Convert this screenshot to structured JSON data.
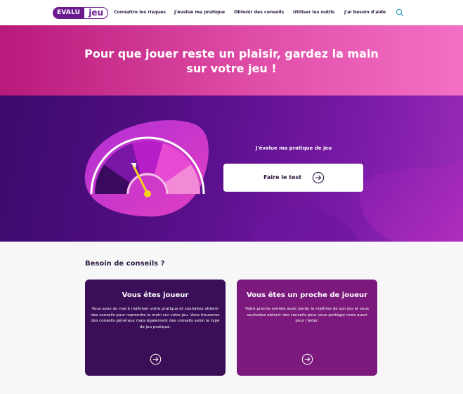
{
  "header": {
    "logo": {
      "left": "EVALU",
      "right": "jeu"
    },
    "nav": [
      {
        "label": "Connaitre les risques"
      },
      {
        "label": "J'évalue ma pratique"
      },
      {
        "label": "Obtenir des conseils"
      },
      {
        "label": "Utiliser les outils"
      },
      {
        "label": "J'ai besoin d'aide"
      }
    ],
    "search_icon": "search-icon"
  },
  "hero": {
    "line1": "Pour que jouer reste un plaisir, gardez la main",
    "line2": "sur votre jeu !"
  },
  "test": {
    "label": "J'évalue ma pratique de jeu",
    "button": "Faire le test",
    "button_icon": "arrow-right-circle-icon",
    "gauge_icon": "gauge-illustration"
  },
  "advice": {
    "title": "Besoin de conseils ?",
    "cards": [
      {
        "title": "Vous êtes joueur",
        "text": "Vous avez du mal à maîtriser votre pratique et souhaitez obtenir des conseils pour reprendre la main sur votre jeu. Vous trouverez des conseils généraux mais également des conseils selon le type de jeu pratiqué.",
        "icon": "arrow-right-circle-icon"
      },
      {
        "title": "Vous êtes un proche de joueur",
        "text": "Votre proche semble avoir perdu la maîtrise de son jeu et vous souhaitez obtenir des conseils pour vous protéger mais aussi pour l'aider.",
        "icon": "arrow-right-circle-icon"
      }
    ]
  },
  "colors": {
    "brand_purple": "#6c1b8f",
    "hero_pink": "#e04da8",
    "card_dark": "#3b0f57",
    "card_magenta": "#7b1a7c",
    "gauge_yellow": "#f7d31c"
  }
}
